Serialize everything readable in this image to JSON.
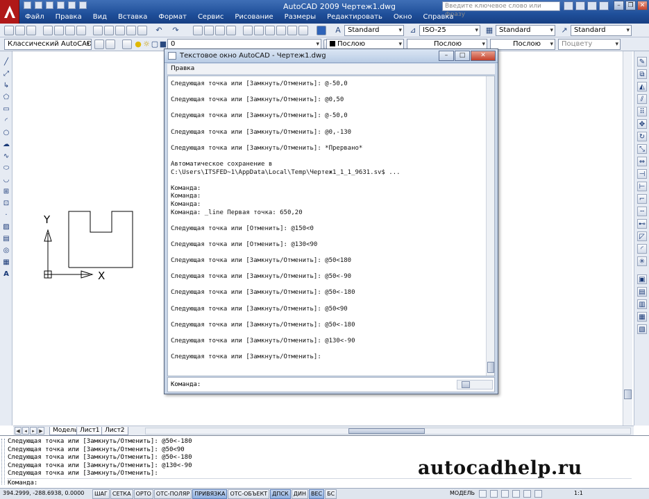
{
  "window": {
    "title": "AutoCAD 2009 Чертеж1.dwg",
    "search_placeholder": "Введите ключевое слово или фразу"
  },
  "menu": [
    "Файл",
    "Правка",
    "Вид",
    "Вставка",
    "Формат",
    "Сервис",
    "Рисование",
    "Размеры",
    "Редактировать",
    "Окно",
    "Справка"
  ],
  "toolbar": {
    "text_style": "Standard",
    "dim_style": "ISO-25",
    "table_style": "Standard",
    "multileader_style": "Standard",
    "workspace": "Классический AutoCAD",
    "layer": "0",
    "color": "Послою",
    "linetype": "Послою",
    "lineweight": "Послою",
    "plot_style": "Поцвету"
  },
  "drawing": {
    "axis_y_label": "Y",
    "axis_x_label": "X"
  },
  "layout_tabs": [
    "Модель",
    "Лист1",
    "Лист2"
  ],
  "text_window": {
    "title": "Текстовое окно AutoCAD - Чертеж1.dwg",
    "menu_edit": "Правка",
    "lines": [
      "Следующая точка или [Замкнуть/Отменить]: @-50,0",
      "",
      "Следующая точка или [Замкнуть/Отменить]: @0,50",
      "",
      "Следующая точка или [Замкнуть/Отменить]: @-50,0",
      "",
      "Следующая точка или [Замкнуть/Отменить]: @0,-130",
      "",
      "Следующая точка или [Замкнуть/Отменить]: *Прервано*",
      "",
      "Автоматическое сохранение в",
      "C:\\Users\\ITSFED~1\\AppData\\Local\\Temp\\Чертеж1_1_1_9631.sv$ ...",
      "",
      "Команда:",
      "Команда:",
      "Команда:",
      "Команда: _line Первая точка: 650,20",
      "",
      "Следующая точка или [Отменить]: @150<0",
      "",
      "Следующая точка или [Отменить]: @130<90",
      "",
      "Следующая точка или [Замкнуть/Отменить]: @50<180",
      "",
      "Следующая точка или [Замкнуть/Отменить]: @50<-90",
      "",
      "Следующая точка или [Замкнуть/Отменить]: @50<-180",
      "",
      "Следующая точка или [Замкнуть/Отменить]: @50<90",
      "",
      "Следующая точка или [Замкнуть/Отменить]: @50<-180",
      "",
      "Следующая точка или [Замкнуть/Отменить]: @130<-90",
      "",
      "Следующая точка или [Замкнуть/Отменить]:"
    ],
    "prompt": "Команда:"
  },
  "command_line": {
    "history": [
      "Следующая точка или [Замкнуть/Отменить]: @50<-180",
      "Следующая точка или [Замкнуть/Отменить]: @50<90",
      "Следующая точка или [Замкнуть/Отменить]: @50<-180",
      "Следующая точка или [Замкнуть/Отменить]: @130<-90",
      "Следующая точка или [Замкнуть/Отменить]:"
    ],
    "prompt": "Команда:"
  },
  "watermark": "autocadhelp.ru",
  "status_bar": {
    "coordinates": "394.2999, -288.6938, 0.0000",
    "toggles": [
      {
        "label": "ШАГ",
        "on": false
      },
      {
        "label": "СЕТКА",
        "on": false
      },
      {
        "label": "ОРТО",
        "on": false
      },
      {
        "label": "ОТС-ПОЛЯР",
        "on": false
      },
      {
        "label": "ПРИВЯЗКА",
        "on": true
      },
      {
        "label": "ОТС-ОБЪЕКТ",
        "on": false
      },
      {
        "label": "ДПСК",
        "on": true
      },
      {
        "label": "ДИН",
        "on": false
      },
      {
        "label": "ВЕС",
        "on": true
      },
      {
        "label": "БС",
        "on": false
      }
    ],
    "model": "МОДЕЛЬ",
    "scale": "1:1"
  },
  "colors": {
    "title_bar": "#1f4f9a",
    "drawing_line": "#000000",
    "active_toggle": "#8fb0e0"
  }
}
